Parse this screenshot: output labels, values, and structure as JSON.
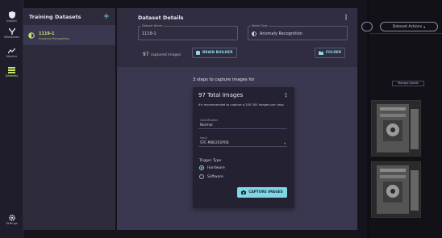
{
  "nav": {
    "items": [
      {
        "label": "Inspect",
        "icon": "shield-icon"
      },
      {
        "label": "Milestones",
        "icon": "milestone-icon"
      },
      {
        "label": "Monitor",
        "icon": "chart-line-icon"
      },
      {
        "label": "Datasets",
        "icon": "stack-icon",
        "active": true
      },
      {
        "label": "Settings",
        "icon": "gear-icon"
      }
    ]
  },
  "datasets_panel": {
    "title": "Training Datasets",
    "add_symbol": "+",
    "items": [
      {
        "name": "1119-1",
        "subtitle": "Anomaly Recognition"
      }
    ]
  },
  "details": {
    "title": "Dataset Details",
    "fields": {
      "dataset_name": {
        "label": "Dataset Name",
        "value": "1119-1"
      },
      "model_type": {
        "label": "Model Type",
        "value": "Anomaly Recognition"
      }
    },
    "captured_count": "97",
    "captured_label": "captured images",
    "brain_builder_label": "BRAIN BUILDER",
    "folder_label": "FOLDER"
  },
  "capture": {
    "instructions": "3 steps to capture images for",
    "card_title": "97 Total Images",
    "card_description": "It's recommended to capture a 200-300 images per class",
    "classification": {
      "label": "Classification",
      "value": "Normal"
    },
    "camera": {
      "label": "Input",
      "value": "STC-MBE202POE"
    },
    "trigger_type_label": "Trigger Type",
    "trigger_options": [
      {
        "label": "Hardware",
        "selected": true
      },
      {
        "label": "Software",
        "selected": false
      }
    ],
    "capture_button_label": "CAPTURE IMAGES"
  },
  "right_panel": {
    "actions_label": "Dataset Actions",
    "chip_label": "Manage Assets"
  },
  "colors": {
    "accent": "#7fd6e6",
    "active_green": "#c6e46a",
    "panel": "#3a3850",
    "sidebar": "#1f1d2b"
  }
}
